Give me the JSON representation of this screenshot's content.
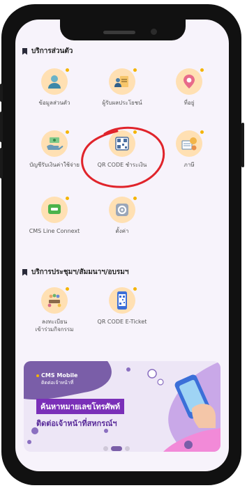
{
  "section_personal": {
    "title": "บริการส่วนตัว"
  },
  "personal_items": [
    {
      "label": "ข้อมูลส่วนตัว",
      "icon": "person-profile-icon"
    },
    {
      "label": "ผู้รับผลประโยชน์",
      "icon": "beneficiary-document-icon"
    },
    {
      "label": "ที่อยู่",
      "icon": "location-pin-icon"
    },
    {
      "label": "บัญชีรับเงินค่าใช้จ่าย",
      "icon": "money-hand-icon"
    },
    {
      "label": "QR CODE ชำระเงิน",
      "icon": "qr-payment-icon"
    },
    {
      "label": "ภาษี",
      "icon": "tax-document-icon"
    },
    {
      "label": "CMS Line Connext",
      "icon": "line-chat-icon"
    },
    {
      "label": "ตั้งค่า",
      "icon": "settings-gear-icon"
    }
  ],
  "section_meeting": {
    "title": "บริการประชุมฯ/สัมมนาฯ/อบรมฯ"
  },
  "meeting_items": [
    {
      "label_line1": "ลงทะเบียน",
      "label_line2": "เข้าร่วมกิจกรรม",
      "icon": "group-meeting-icon"
    },
    {
      "label_line1": "QR CODE E-Ticket",
      "label_line2": "",
      "icon": "qr-phone-ticket-icon"
    }
  ],
  "banner": {
    "brand": "CMS Mobile",
    "tagline": "ติดต่อเจ้าหน้าที่",
    "headline_line1": "ค้นหาหมายเลขโทรศัพท์",
    "headline_line2": "ติดต่อเจ้าหน้าที่สหกรณ์ฯ"
  },
  "carousel": {
    "count": 3,
    "active_index": 1
  },
  "colors": {
    "accent": "#7a5ea8",
    "icon_bg": "#ffe4a8",
    "annotation": "#e0242b"
  }
}
